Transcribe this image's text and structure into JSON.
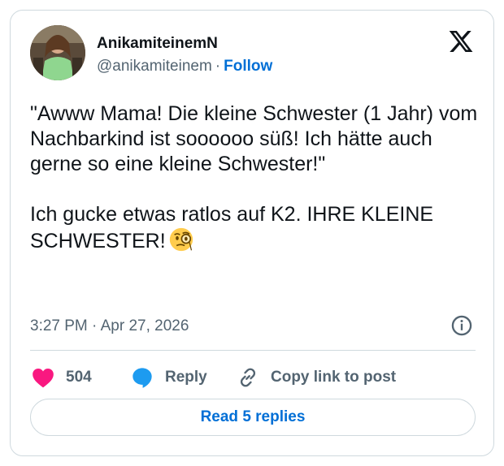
{
  "author": {
    "display_name": "AnikamiteinemN",
    "handle": "@anikamiteinem",
    "separator": "·",
    "follow_label": "Follow"
  },
  "post": {
    "text": "\"Awww Mama! Die kleine Schwester (1 Jahr) vom Nachbarkind ist soooooo süß! Ich hätte auch gerne so eine kleine Schwester!\"\n\nIch gucke etwas ratlos auf K2. IHRE KLEINE SCHWESTER!",
    "emoji": "face-with-monocle",
    "time": "3:27 PM",
    "date_separator": "·",
    "date": "Apr 27, 2026"
  },
  "actions": {
    "like_count": "504",
    "reply_label": "Reply",
    "copy_label": "Copy link to post"
  },
  "footer": {
    "read_replies_label": "Read 5 replies"
  },
  "colors": {
    "link_blue": "#006fd6",
    "like_pink": "#f91880",
    "reply_blue": "#1d9bf0",
    "muted": "#536471",
    "border": "#cfd9de"
  }
}
